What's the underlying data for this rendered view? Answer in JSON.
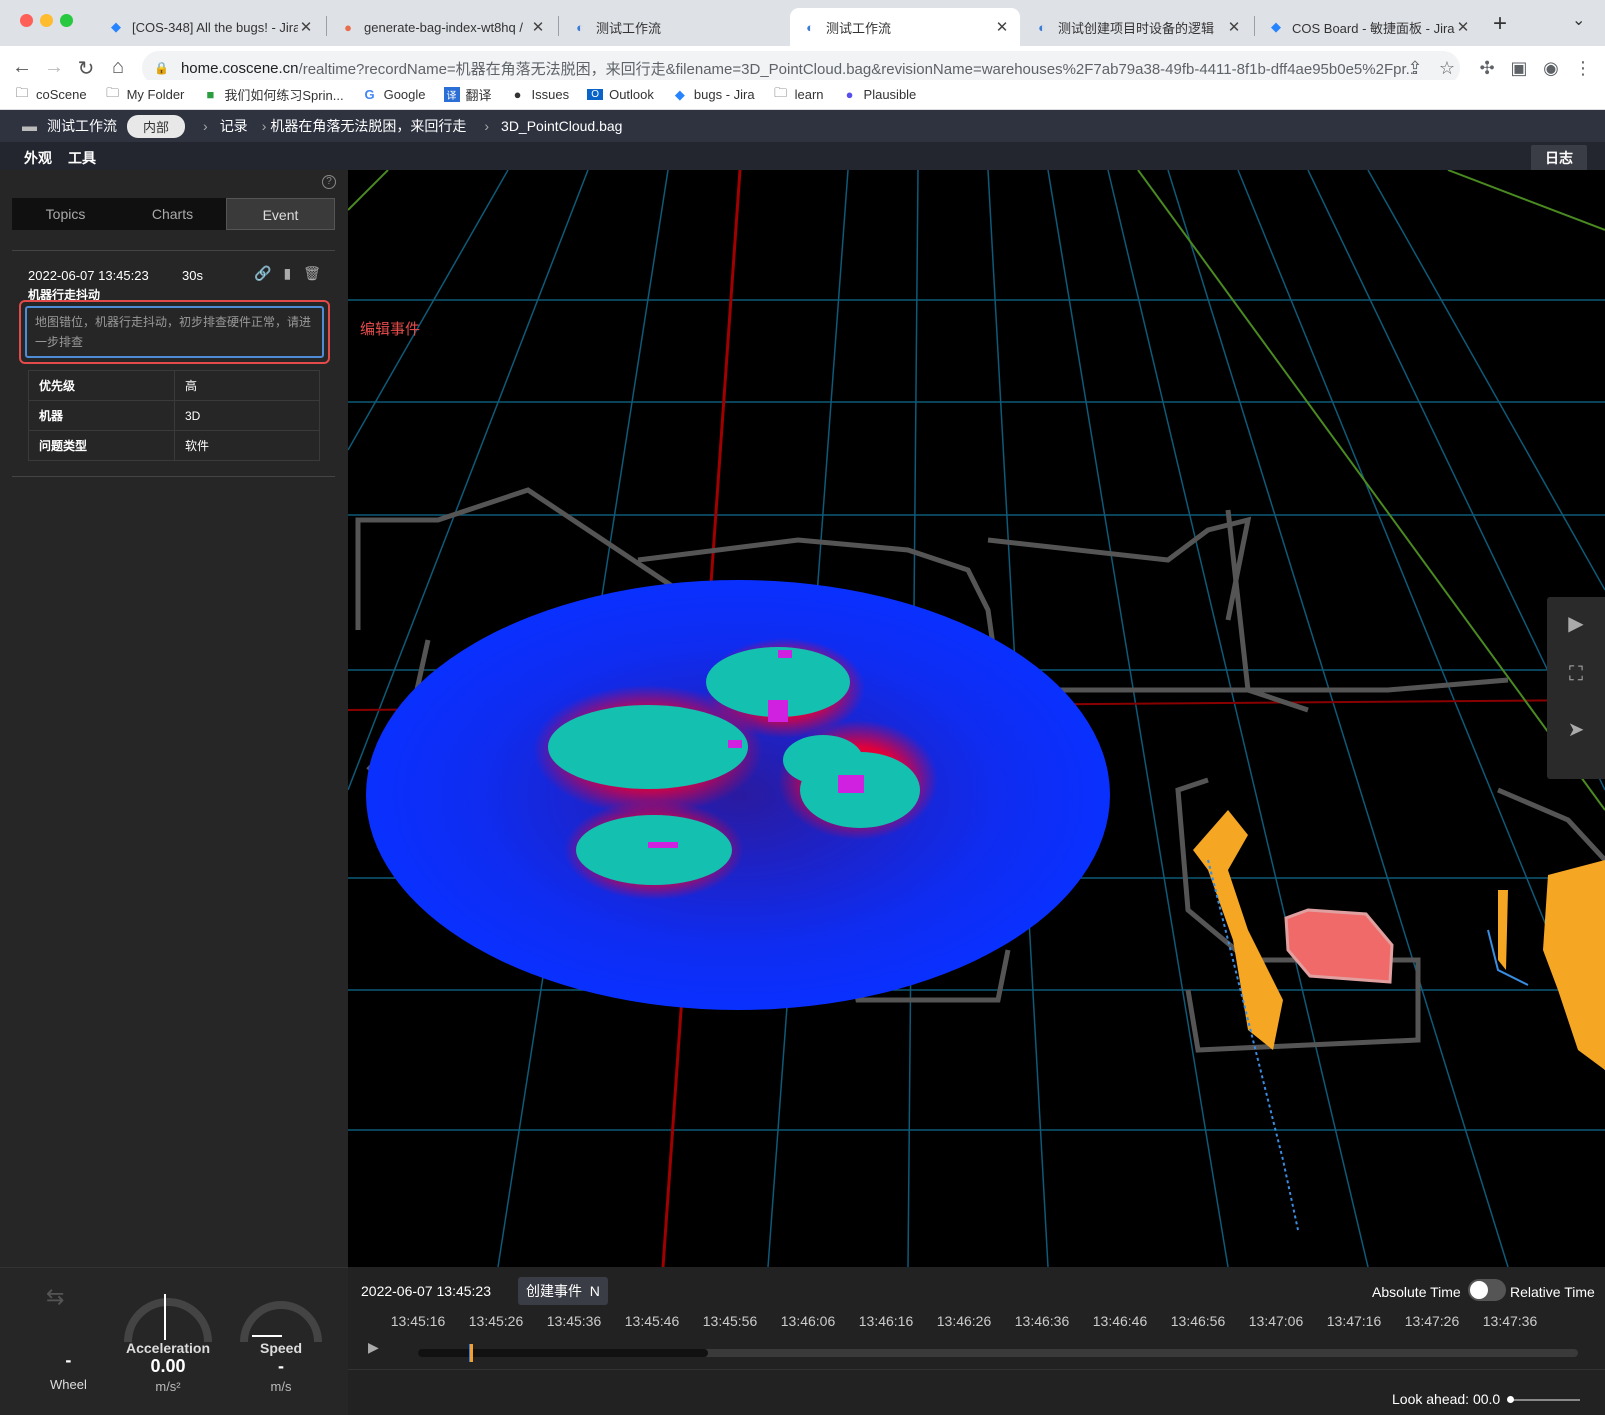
{
  "browser": {
    "tabs": [
      {
        "title": "[COS-348] All the bugs! - Jira",
        "icon": "jira-icon"
      },
      {
        "title": "generate-bag-index-wt8hq /",
        "icon": "argo-icon"
      },
      {
        "title": "测试工作流",
        "icon": "coscene-icon"
      },
      {
        "title": "测试工作流",
        "icon": "coscene-icon",
        "active": true
      },
      {
        "title": "测试创建项目时设备的逻辑",
        "icon": "coscene-icon"
      },
      {
        "title": "COS Board - 敏捷面板 - Jira",
        "icon": "jira-icon"
      }
    ],
    "url_host": "home.coscene.cn",
    "url_path": "/realtime?recordName=机器在角落无法脱困，来回行走&filename=3D_PointCloud.bag&revisionName=warehouses%2F7ab79a38-49fb-4411-8f1b-dff4ae95b0e5%2Fpr...",
    "bookmarks": [
      {
        "label": "coScene",
        "icon": "folder-icon"
      },
      {
        "label": "My Folder",
        "icon": "folder-icon"
      },
      {
        "label": "我们如何练习Sprin...",
        "icon": "sprint-icon"
      },
      {
        "label": "Google",
        "icon": "google-icon"
      },
      {
        "label": "翻译",
        "icon": "translate-icon"
      },
      {
        "label": "Issues",
        "icon": "github-icon"
      },
      {
        "label": "Outlook",
        "icon": "outlook-icon"
      },
      {
        "label": "bugs - Jira",
        "icon": "jira-icon"
      },
      {
        "label": "learn",
        "icon": "folder-icon"
      },
      {
        "label": "Plausible",
        "icon": "plausible-icon"
      }
    ]
  },
  "header": {
    "project": "测试工作流",
    "visibility": "内部",
    "crumb_records": "记录",
    "crumb_record": "机器在角落无法脱困，来回行走",
    "crumb_file": "3D_PointCloud.bag",
    "menu_appearance": "外观",
    "menu_tools": "工具",
    "log_button": "日志"
  },
  "panel": {
    "tabs": [
      "Topics",
      "Charts",
      "Event"
    ],
    "active_tab": "Event",
    "event": {
      "time": "2022-06-07 13:45:23",
      "duration": "30s",
      "title": "机器行走抖动",
      "description": "地图错位，机器行走抖动，初步排查硬件正常，请进一步排查",
      "properties": [
        {
          "key": "优先级",
          "value": "高"
        },
        {
          "key": "机器",
          "value": "3D"
        },
        {
          "key": "问题类型",
          "value": "软件"
        }
      ]
    }
  },
  "annotation": {
    "edit_event": "编辑事件"
  },
  "gauges": {
    "wheel": {
      "value": "-",
      "label": "Wheel"
    },
    "acceleration": {
      "label": "Acceleration",
      "value": "0.00",
      "unit": "m/s²"
    },
    "speed": {
      "label": "Speed",
      "value": "-",
      "unit": "m/s"
    }
  },
  "timeline": {
    "current_time": "2022-06-07 13:45:23",
    "create_event": "创建事件",
    "create_event_shortcut": "N",
    "absolute_time": "Absolute Time",
    "relative_time": "Relative Time",
    "ticks": [
      "13:45:16",
      "13:45:26",
      "13:45:36",
      "13:45:46",
      "13:45:56",
      "13:46:06",
      "13:46:16",
      "13:46:26",
      "13:46:36",
      "13:46:46",
      "13:46:56",
      "13:47:06",
      "13:47:16",
      "13:47:26",
      "13:47:36"
    ],
    "buffered_fraction": 0.25,
    "playhead_fraction": 0.044,
    "look_ahead": "Look ahead: 00.0"
  }
}
